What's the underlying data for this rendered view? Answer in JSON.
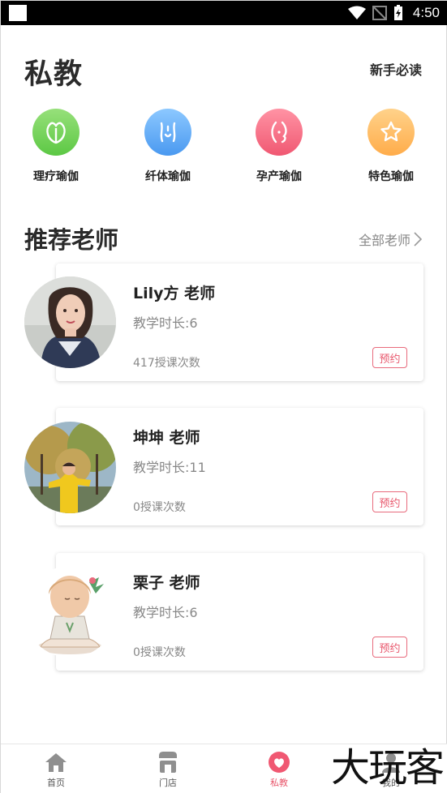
{
  "status_bar": {
    "time": "4:50"
  },
  "header": {
    "title": "私教",
    "guide_link": "新手必读"
  },
  "categories": [
    {
      "label": "理疗瑜伽",
      "icon": "leaf-icon",
      "color_top": "#97e07a",
      "color_bottom": "#5cc844"
    },
    {
      "label": "纤体瑜伽",
      "icon": "body-curve-icon",
      "color_top": "#8cc8ff",
      "color_bottom": "#4a99f0"
    },
    {
      "label": "孕产瑜伽",
      "icon": "pregnancy-icon",
      "color_top": "#ff93a4",
      "color_bottom": "#f05872"
    },
    {
      "label": "特色瑜伽",
      "icon": "star-icon",
      "color_top": "#ffd28a",
      "color_bottom": "#ffac4a"
    }
  ],
  "recommend": {
    "title": "推荐老师",
    "all_link": "全部老师",
    "teachers": [
      {
        "name": "Lily方 老师",
        "teaching_time": "教学时长:6",
        "lesson_count": "417授课次数",
        "book_label": "预约"
      },
      {
        "name": "坤坤 老师",
        "teaching_time": "教学时长:11",
        "lesson_count": "0授课次数",
        "book_label": "预约"
      },
      {
        "name": "栗子 老师",
        "teaching_time": "教学时长:6",
        "lesson_count": "0授课次数",
        "book_label": "预约"
      }
    ]
  },
  "bottom_nav": [
    {
      "label": "首页",
      "icon": "home-icon",
      "active": false
    },
    {
      "label": "门店",
      "icon": "store-icon",
      "active": false
    },
    {
      "label": "私教",
      "icon": "heart-icon",
      "active": true
    },
    {
      "label": "我的",
      "icon": "profile-icon",
      "active": false
    }
  ],
  "watermark": "大玩客",
  "colors": {
    "accent": "#e8576c",
    "text": "#222222",
    "muted": "#888888"
  }
}
